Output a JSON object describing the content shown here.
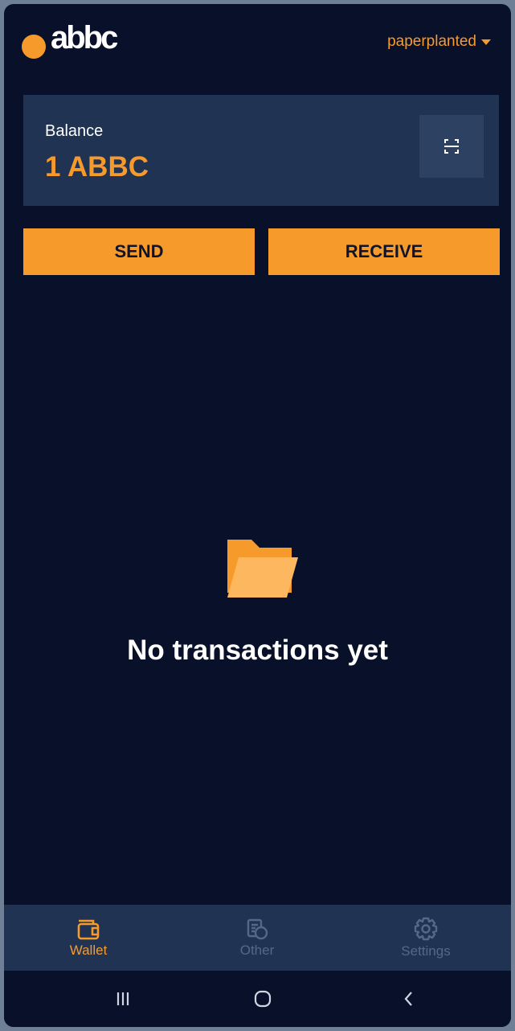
{
  "header": {
    "logo_text": "abbc",
    "account_name": "paperplanted",
    "colors": {
      "accent": "#f79a2c",
      "background": "#09102a",
      "card": "#213352"
    }
  },
  "balance": {
    "label": "Balance",
    "value": "1 ABBC",
    "scan_icon": "scan-icon"
  },
  "actions": {
    "send_label": "SEND",
    "receive_label": "RECEIVE"
  },
  "empty_state": {
    "icon": "folder-icon",
    "message": "No transactions yet"
  },
  "bottom_nav": {
    "items": [
      {
        "label": "Wallet",
        "icon": "wallet-icon",
        "active": true
      },
      {
        "label": "Other",
        "icon": "coins-icon",
        "active": false
      },
      {
        "label": "Settings",
        "icon": "gear-icon",
        "active": false
      }
    ]
  },
  "system_bar": {
    "buttons": [
      "recent-apps-icon",
      "home-icon",
      "back-icon"
    ]
  }
}
